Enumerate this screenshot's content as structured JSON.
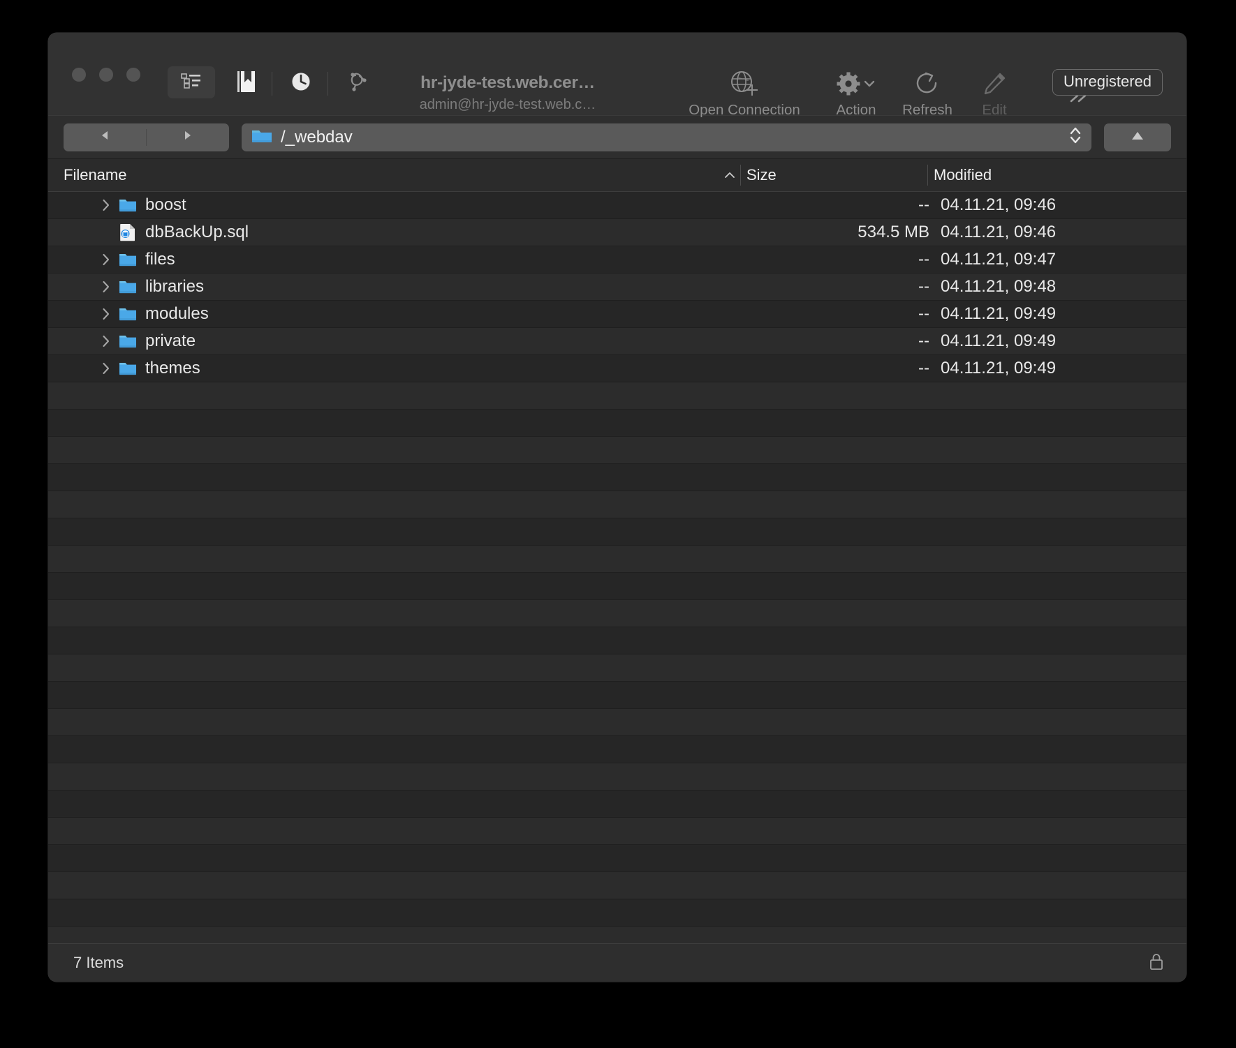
{
  "window": {
    "title": "hr-jyde-test.web.cer…",
    "subtitle": "admin@hr-jyde-test.web.c…",
    "badge": "Unregistered"
  },
  "toolbar": {
    "view_mode_icon": "list-view-icon",
    "bookmarks_icon": "bookmark-icon",
    "history_icon": "clock-icon",
    "vault_icon": "cryptomator-vault-icon",
    "overflow_icon": "chevron-double-right-icon",
    "items": [
      {
        "label": "Open Connection",
        "icon": "globe-plus-icon",
        "enabled": true
      },
      {
        "label": "Action",
        "icon": "gear-icon",
        "enabled": true
      },
      {
        "label": "Refresh",
        "icon": "refresh-icon",
        "enabled": true
      },
      {
        "label": "Edit",
        "icon": "pencil-icon",
        "enabled": false
      }
    ]
  },
  "navbar": {
    "back_icon": "triangle-left-icon",
    "forward_icon": "triangle-right-icon",
    "path_icon": "folder-icon",
    "path_value": "/_webdav",
    "stepper_icon": "chevron-up-down-icon",
    "up_icon": "triangle-up-icon"
  },
  "columns": {
    "filename": "Filename",
    "size": "Size",
    "modified": "Modified",
    "sort_indicator": "sort-ascending-icon"
  },
  "files": [
    {
      "name": "boost",
      "icon": "folder-icon",
      "expandable": true,
      "size": "--",
      "modified": "04.11.21, 09:46"
    },
    {
      "name": "dbBackUp.sql",
      "icon": "sql-file-icon",
      "expandable": false,
      "size": "534.5 MB",
      "modified": "04.11.21, 09:46"
    },
    {
      "name": "files",
      "icon": "folder-icon",
      "expandable": true,
      "size": "--",
      "modified": "04.11.21, 09:47"
    },
    {
      "name": "libraries",
      "icon": "folder-icon",
      "expandable": true,
      "size": "--",
      "modified": "04.11.21, 09:48"
    },
    {
      "name": "modules",
      "icon": "folder-icon",
      "expandable": true,
      "size": "--",
      "modified": "04.11.21, 09:49"
    },
    {
      "name": "private",
      "icon": "folder-icon",
      "expandable": true,
      "size": "--",
      "modified": "04.11.21, 09:49"
    },
    {
      "name": "themes",
      "icon": "folder-icon",
      "expandable": true,
      "size": "--",
      "modified": "04.11.21, 09:49"
    }
  ],
  "statusbar": {
    "count": "7 Items",
    "lock_icon": "lock-icon"
  },
  "colors": {
    "folder_blue": "#4aa8e8",
    "window_bg": "#2b2b2b",
    "toolbar_bg": "#323232",
    "list_bg": "#262626",
    "row_alt_bg": "#2c2c2c",
    "text": "#e8e8e8",
    "dim_text": "#8d8d8d"
  }
}
